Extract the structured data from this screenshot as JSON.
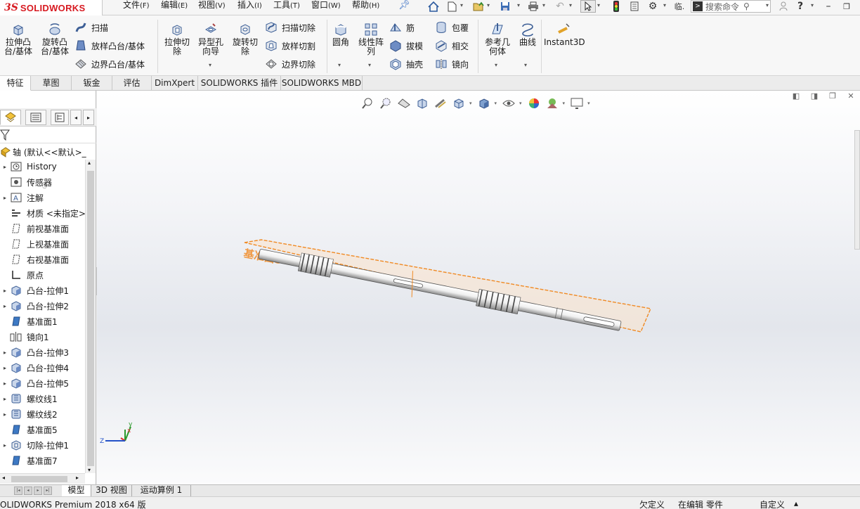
{
  "app": {
    "logo_ds": "3S",
    "logo_name": "SOLIDWORKS"
  },
  "menu": [
    {
      "label": "文件",
      "key": "(F)"
    },
    {
      "label": "编辑",
      "key": "(E)"
    },
    {
      "label": "视图",
      "key": "(V)"
    },
    {
      "label": "插入",
      "key": "(I)"
    },
    {
      "label": "工具",
      "key": "(T)"
    },
    {
      "label": "窗口",
      "key": "(W)"
    },
    {
      "label": "帮助",
      "key": "(H)"
    }
  ],
  "quick_access": {
    "options_label": "临.",
    "search_placeholder": "搜索命令"
  },
  "commands": {
    "extrude_boss": "拉伸凸\n台/基体",
    "revolve_boss": "旋转凸\n台/基体",
    "sweep": "扫描",
    "loft_boss": "放样凸台/基体",
    "boundary_boss": "边界凸台/基体",
    "extrude_cut": "拉伸切\n除",
    "hole_wizard": "异型孔\n向导",
    "revolve_cut": "旋转切\n除",
    "swept_cut": "扫描切除",
    "lofted_cut": "放样切割",
    "boundary_cut": "边界切除",
    "fillet": "圆角",
    "linear_pattern": "线性阵\n列",
    "rib": "筋",
    "draft": "拔模",
    "shell": "抽壳",
    "wrap": "包覆",
    "intersect": "相交",
    "mirror": "镜向",
    "ref_geometry": "参考几\n何体",
    "curves": "曲线",
    "instant3d": "Instant3D"
  },
  "tabs": [
    "特征",
    "草图",
    "钣金",
    "评估",
    "DimXpert",
    "SOLIDWORKS 插件",
    "SOLIDWORKS MBD"
  ],
  "feature_tree": {
    "root": "轴 (默认<<默认>_",
    "items": [
      {
        "label": "History",
        "icon": "history-icon",
        "expand": true
      },
      {
        "label": "传感器",
        "icon": "sensor-icon",
        "expand": false
      },
      {
        "label": "注解",
        "icon": "annotation-icon",
        "expand": true
      },
      {
        "label": "材质 <未指定>",
        "icon": "material-icon",
        "expand": false
      },
      {
        "label": "前视基准面",
        "icon": "plane-icon",
        "expand": false
      },
      {
        "label": "上视基准面",
        "icon": "plane-icon",
        "expand": false
      },
      {
        "label": "右视基准面",
        "icon": "plane-icon",
        "expand": false
      },
      {
        "label": "原点",
        "icon": "origin-icon",
        "expand": false
      },
      {
        "label": "凸台-拉伸1",
        "icon": "extrude-icon",
        "expand": true
      },
      {
        "label": "凸台-拉伸2",
        "icon": "extrude-icon",
        "expand": true
      },
      {
        "label": "基准面1",
        "icon": "ref-plane-icon",
        "expand": false
      },
      {
        "label": "镜向1",
        "icon": "mirror-icon",
        "expand": false
      },
      {
        "label": "凸台-拉伸3",
        "icon": "extrude-icon",
        "expand": true
      },
      {
        "label": "凸台-拉伸4",
        "icon": "extrude-icon",
        "expand": true
      },
      {
        "label": "凸台-拉伸5",
        "icon": "extrude-icon",
        "expand": true
      },
      {
        "label": "螺纹线1",
        "icon": "helix-icon",
        "expand": true
      },
      {
        "label": "螺纹线2",
        "icon": "helix-icon",
        "expand": true
      },
      {
        "label": "基准面5",
        "icon": "ref-plane-icon",
        "expand": false
      },
      {
        "label": "切除-拉伸1",
        "icon": "cut-extrude-icon",
        "expand": true
      },
      {
        "label": "基准面7",
        "icon": "ref-plane-icon",
        "expand": false
      }
    ]
  },
  "viewport": {
    "plane_label": "基准面5",
    "triad": {
      "x": "x",
      "y": "y",
      "z": "Z"
    }
  },
  "bottom_tabs": [
    "模型",
    "3D 视图",
    "运动算例 1"
  ],
  "status": {
    "product": "OLIDWORKS Premium 2018 x64 版",
    "defined": "欠定义",
    "editing": "在编辑 零件",
    "units": "自定义"
  },
  "colors": {
    "accent": "#d71920",
    "selection": "#f08a24",
    "plane_fill": "#fbe3cc"
  }
}
